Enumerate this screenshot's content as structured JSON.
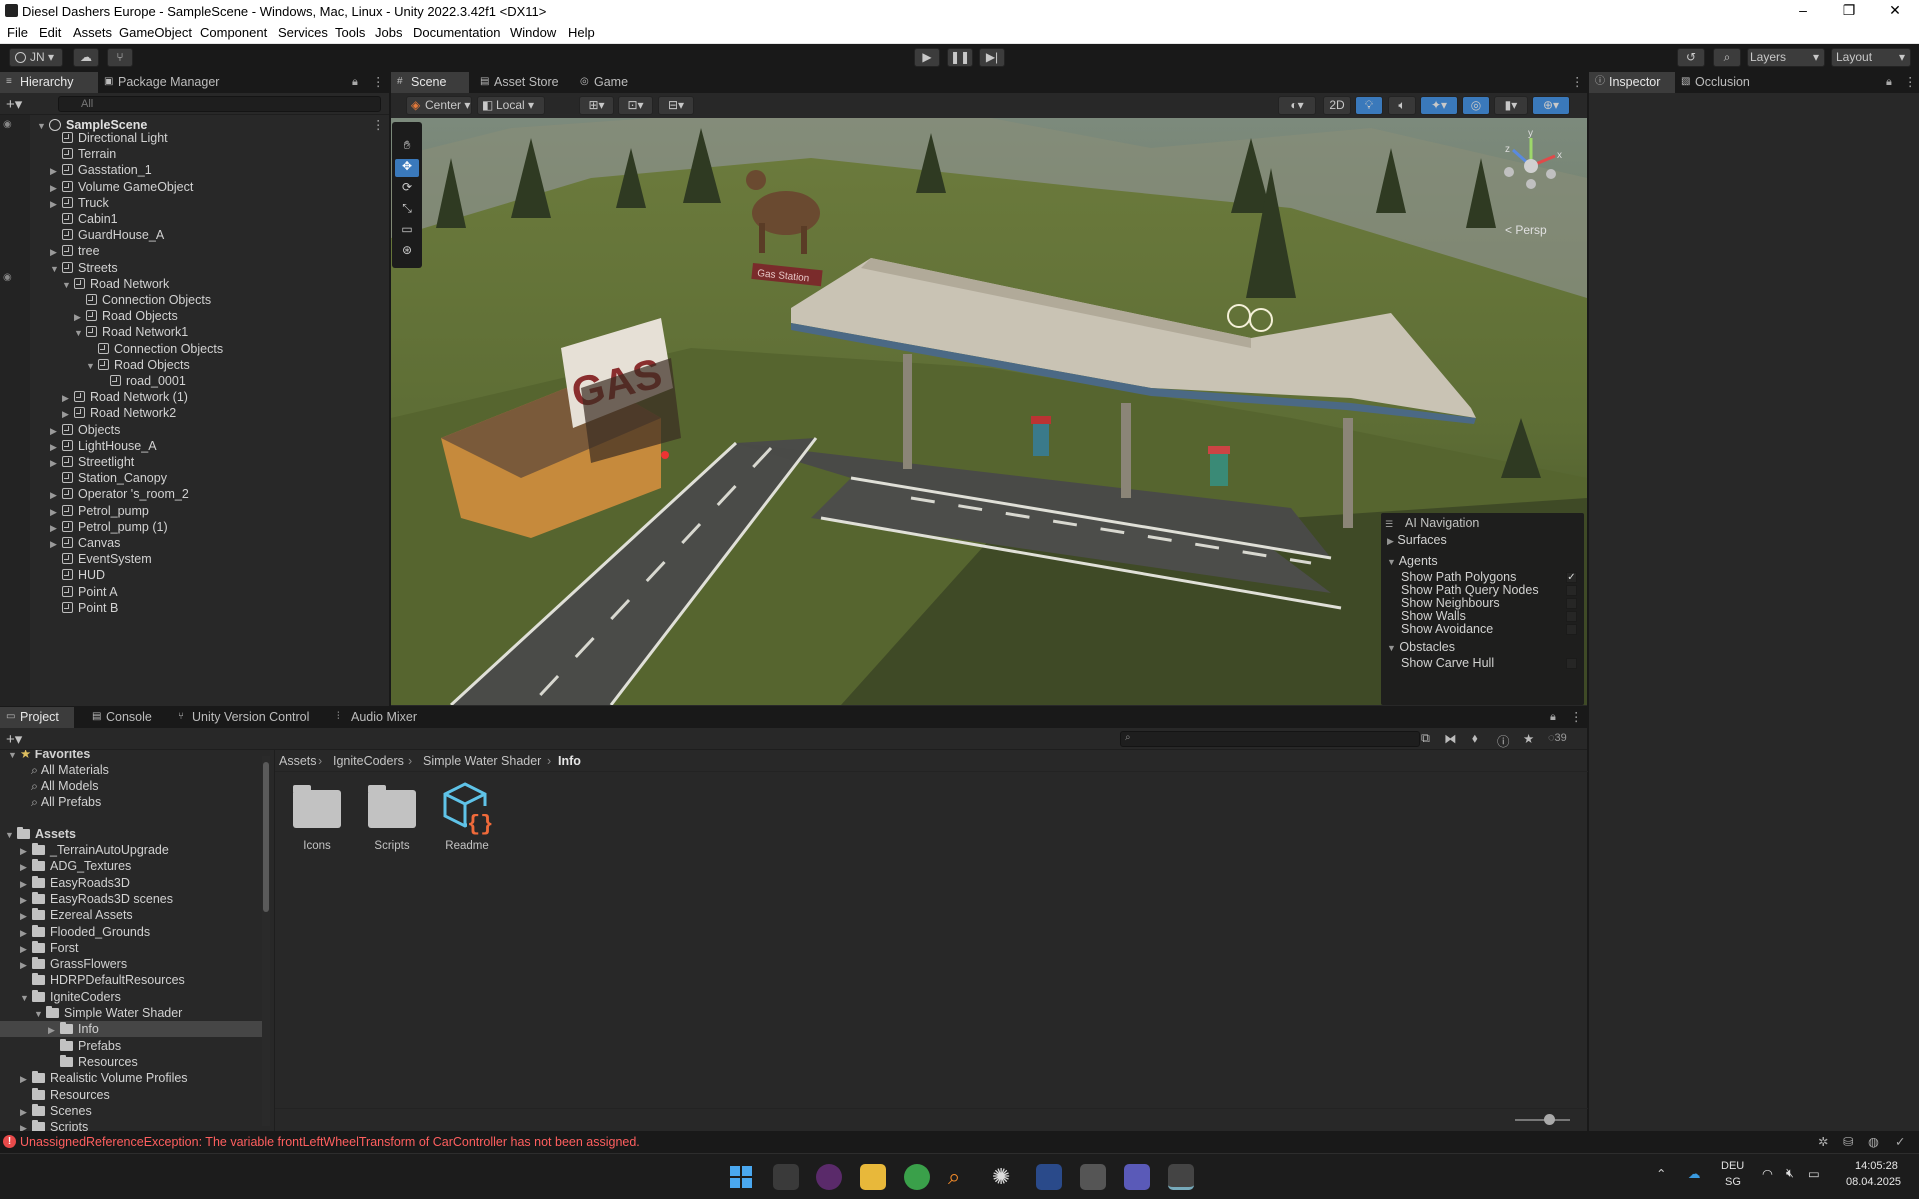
{
  "window": {
    "title": "Diesel Dashers Europe - SampleScene - Windows, Mac, Linux - Unity 2022.3.42f1 <DX11>"
  },
  "menu": [
    "File",
    "Edit",
    "Assets",
    "GameObject",
    "Component",
    "Services",
    "Tools",
    "Jobs",
    "Documentation",
    "Window",
    "Help"
  ],
  "toolbar": {
    "account": "JN",
    "layers": "Layers",
    "layout": "Layout"
  },
  "hierarchy": {
    "tabs": [
      "Hierarchy",
      "Package Manager"
    ],
    "search_placeholder": "All",
    "scene": "SampleScene",
    "items": [
      {
        "label": "Directional Light",
        "depth": 1,
        "arrow": ""
      },
      {
        "label": "Terrain",
        "depth": 1,
        "arrow": ""
      },
      {
        "label": "Gasstation_1",
        "depth": 1,
        "arrow": "▶"
      },
      {
        "label": "Volume GameObject",
        "depth": 1,
        "arrow": "▶"
      },
      {
        "label": "Truck",
        "depth": 1,
        "arrow": "▶"
      },
      {
        "label": "Cabin1",
        "depth": 1,
        "arrow": ""
      },
      {
        "label": "GuardHouse_A",
        "depth": 1,
        "arrow": ""
      },
      {
        "label": "tree",
        "depth": 1,
        "arrow": "▶"
      },
      {
        "label": "Streets",
        "depth": 1,
        "arrow": "▼"
      },
      {
        "label": "Road Network",
        "depth": 2,
        "arrow": "▼"
      },
      {
        "label": "Connection Objects",
        "depth": 3,
        "arrow": ""
      },
      {
        "label": "Road Objects",
        "depth": 3,
        "arrow": "▶"
      },
      {
        "label": "Road Network1",
        "depth": 3,
        "arrow": "▼"
      },
      {
        "label": "Connection Objects",
        "depth": 4,
        "arrow": ""
      },
      {
        "label": "Road Objects",
        "depth": 4,
        "arrow": "▼"
      },
      {
        "label": "road_0001",
        "depth": 5,
        "arrow": ""
      },
      {
        "label": "Road Network (1)",
        "depth": 2,
        "arrow": "▶"
      },
      {
        "label": "Road Network2",
        "depth": 2,
        "arrow": "▶"
      },
      {
        "label": "Objects",
        "depth": 1,
        "arrow": "▶"
      },
      {
        "label": "LightHouse_A",
        "depth": 1,
        "arrow": "▶"
      },
      {
        "label": "Streetlight",
        "depth": 1,
        "arrow": "▶"
      },
      {
        "label": "Station_Canopy",
        "depth": 1,
        "arrow": ""
      },
      {
        "label": "Operator 's_room_2",
        "depth": 1,
        "arrow": "▶"
      },
      {
        "label": "Petrol_pump",
        "depth": 1,
        "arrow": "▶"
      },
      {
        "label": "Petrol_pump (1)",
        "depth": 1,
        "arrow": "▶"
      },
      {
        "label": "Canvas",
        "depth": 1,
        "arrow": "▶"
      },
      {
        "label": "EventSystem",
        "depth": 1,
        "arrow": ""
      },
      {
        "label": "HUD",
        "depth": 1,
        "arrow": ""
      },
      {
        "label": "Point A",
        "depth": 1,
        "arrow": ""
      },
      {
        "label": "Point B",
        "depth": 1,
        "arrow": ""
      }
    ]
  },
  "scene": {
    "tabs": [
      "Scene",
      "Asset Store",
      "Game"
    ],
    "pivot": "Center",
    "space": "Local",
    "mode2d": "2D",
    "persp": "< Persp",
    "gizmo_axes": {
      "x": "x",
      "y": "y",
      "z": "z"
    },
    "ai_nav": {
      "title": "AI Navigation",
      "surfaces": "Surfaces",
      "agents": "Agents",
      "obstacles": "Obstacles",
      "options": [
        {
          "label": "Show Path Polygons",
          "checked": true
        },
        {
          "label": "Show Path Query Nodes",
          "checked": false
        },
        {
          "label": "Show Neighbours",
          "checked": false
        },
        {
          "label": "Show Walls",
          "checked": false
        },
        {
          "label": "Show Avoidance",
          "checked": false
        }
      ],
      "carve": {
        "label": "Show Carve Hull",
        "checked": false
      }
    },
    "sign_text": "GAS",
    "small_sign": "Gas Station"
  },
  "inspector": {
    "tabs": [
      "Inspector",
      "Occlusion"
    ]
  },
  "project": {
    "tabs": [
      "Project",
      "Console",
      "Unity Version Control",
      "Audio Mixer"
    ],
    "favorites_label": "Favorites",
    "favorites": [
      "All Materials",
      "All Models",
      "All Prefabs"
    ],
    "assets_label": "Assets",
    "tree": [
      {
        "label": "_TerrainAutoUpgrade",
        "depth": 1,
        "arrow": "▶"
      },
      {
        "label": "ADG_Textures",
        "depth": 1,
        "arrow": "▶"
      },
      {
        "label": "EasyRoads3D",
        "depth": 1,
        "arrow": "▶"
      },
      {
        "label": "EasyRoads3D scenes",
        "depth": 1,
        "arrow": "▶"
      },
      {
        "label": "Ezereal Assets",
        "depth": 1,
        "arrow": "▶"
      },
      {
        "label": "Flooded_Grounds",
        "depth": 1,
        "arrow": "▶"
      },
      {
        "label": "Forst",
        "depth": 1,
        "arrow": "▶"
      },
      {
        "label": "GrassFlowers",
        "depth": 1,
        "arrow": "▶"
      },
      {
        "label": "HDRPDefaultResources",
        "depth": 1,
        "arrow": ""
      },
      {
        "label": "IgniteCoders",
        "depth": 1,
        "arrow": "▼"
      },
      {
        "label": "Simple Water Shader",
        "depth": 2,
        "arrow": "▼"
      },
      {
        "label": "Info",
        "depth": 3,
        "arrow": "▶",
        "selected": true
      },
      {
        "label": "Prefabs",
        "depth": 3,
        "arrow": ""
      },
      {
        "label": "Resources",
        "depth": 3,
        "arrow": ""
      },
      {
        "label": "Realistic Volume Profiles",
        "depth": 1,
        "arrow": "▶"
      },
      {
        "label": "Resources",
        "depth": 1,
        "arrow": ""
      },
      {
        "label": "Scenes",
        "depth": 1,
        "arrow": "▶"
      },
      {
        "label": "Scripts",
        "depth": 1,
        "arrow": "▶"
      }
    ],
    "breadcrumb": [
      "Assets",
      "IgniteCoders",
      "Simple Water Shader",
      "Info"
    ],
    "files": [
      {
        "label": "Icons",
        "kind": "folder"
      },
      {
        "label": "Scripts",
        "kind": "folder"
      },
      {
        "label": "Readme",
        "kind": "script"
      }
    ],
    "hidden_count": "39"
  },
  "status": {
    "error": "UnassignedReferenceException: The variable frontLeftWheelTransform of CarController has not been assigned."
  },
  "taskbar": {
    "lang": "DEU",
    "region": "SG",
    "time": "14:05:28",
    "date": "08.04.2025"
  },
  "colors": {
    "accent": "#3a79bb",
    "error": "#ff5f5f",
    "selected": "#2c5d87"
  }
}
